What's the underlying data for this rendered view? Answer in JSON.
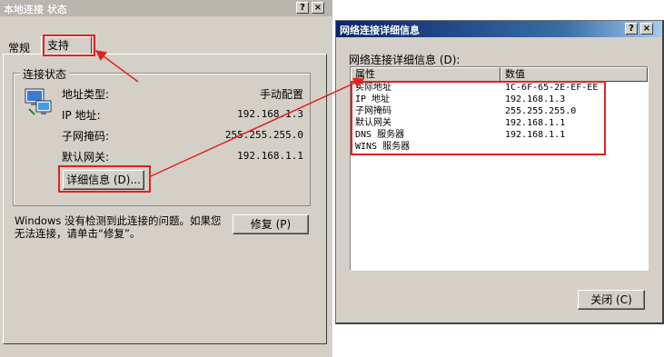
{
  "left_window": {
    "title": "本地连接 状态",
    "tabs": [
      {
        "label": "常规"
      },
      {
        "label": "支持"
      }
    ],
    "group_title": "连接状态",
    "rows": [
      {
        "label": "地址类型:",
        "value": "手动配置"
      },
      {
        "label": "IP 地址:",
        "value": "192.168.1.3"
      },
      {
        "label": "子网掩码:",
        "value": "255.255.255.0"
      },
      {
        "label": "默认网关:",
        "value": "192.168.1.1"
      }
    ],
    "details_button": "详细信息 (D)...",
    "message": "Windows 没有检测到此连接的问题。如果您无法连接，请单击“修复”。",
    "repair_button": "修复 (P)"
  },
  "right_window": {
    "title": "网络连接详细信息",
    "caption": "网络连接详细信息 (D):",
    "columns": {
      "property": "属性",
      "value": "数值"
    },
    "rows": [
      {
        "property": "实际地址",
        "value": "1C-6F-65-2E-EF-EE"
      },
      {
        "property": "IP 地址",
        "value": "192.168.1.3"
      },
      {
        "property": "子网掩码",
        "value": "255.255.255.0"
      },
      {
        "property": "默认网关",
        "value": "192.168.1.1"
      },
      {
        "property": "DNS 服务器",
        "value": "192.168.1.1"
      },
      {
        "property": "WINS 服务器",
        "value": ""
      }
    ],
    "close_button": "关闭 (C)"
  },
  "title_buttons": {
    "help": "?",
    "close": "×"
  },
  "colors": {
    "annotation_red": "#e0221f",
    "face": "#d4d0c8"
  }
}
